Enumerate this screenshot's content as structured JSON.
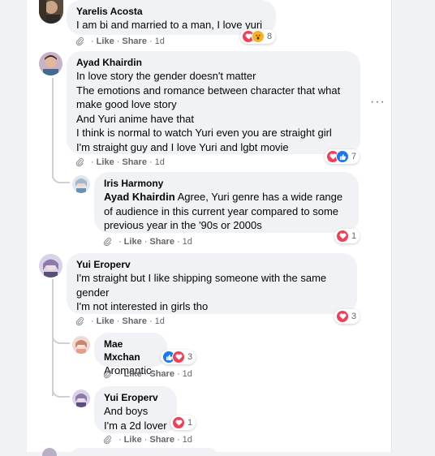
{
  "comments": [
    {
      "name": "Yarelis Acosta",
      "lines": [
        "I am bi and married to a man, I love yuri"
      ],
      "like": "Like",
      "share": "Share",
      "time": "1d",
      "reaction_count": "8"
    },
    {
      "name": "Ayad Khairdin",
      "lines": [
        "In love story the gender doesn't matter",
        "The emotions and romance between character that what",
        "make good love story",
        "And Yuri anime have that",
        "I think is normal to watch Yuri even you are straight girl",
        "I'm straight guy and I love Yuri and lgbt movie"
      ],
      "like": "Like",
      "share": "Share",
      "time": "1d",
      "reaction_count": "7"
    },
    {
      "name": "Iris Harmony",
      "mention": "Ayad Khairdin",
      "lines": [
        "Agree, Yuri genre has a wide range",
        "of audience in this current year compared to some",
        "previous year in the '90s or 2000s"
      ],
      "like": "Like",
      "share": "Share",
      "time": "1d",
      "reaction_count": "1"
    },
    {
      "name": "Yui Eroperv",
      "lines": [
        "I'm straight but I like shipping someone with the same",
        "gender",
        "I'm not interested in girls tho"
      ],
      "like": "Like",
      "share": "Share",
      "time": "1d",
      "reaction_count": "3"
    },
    {
      "name": "Mae Mxchan",
      "lines": [
        "Aromantic-"
      ],
      "like": "Like",
      "share": "Share",
      "time": "1d",
      "reaction_count": "3"
    },
    {
      "name": "Yui Eroperv",
      "lines": [
        "And boys",
        "I'm a 2d lover"
      ],
      "like": "Like",
      "share": "Share",
      "time": "1d",
      "reaction_count": "1"
    }
  ],
  "more_icon": "more-horizontal-icon",
  "colors": {
    "love": "#f33e58",
    "like": "#1877f2",
    "wow": "#f7b125",
    "text_secondary": "#65676b",
    "bubble": "#f0f2f5"
  }
}
